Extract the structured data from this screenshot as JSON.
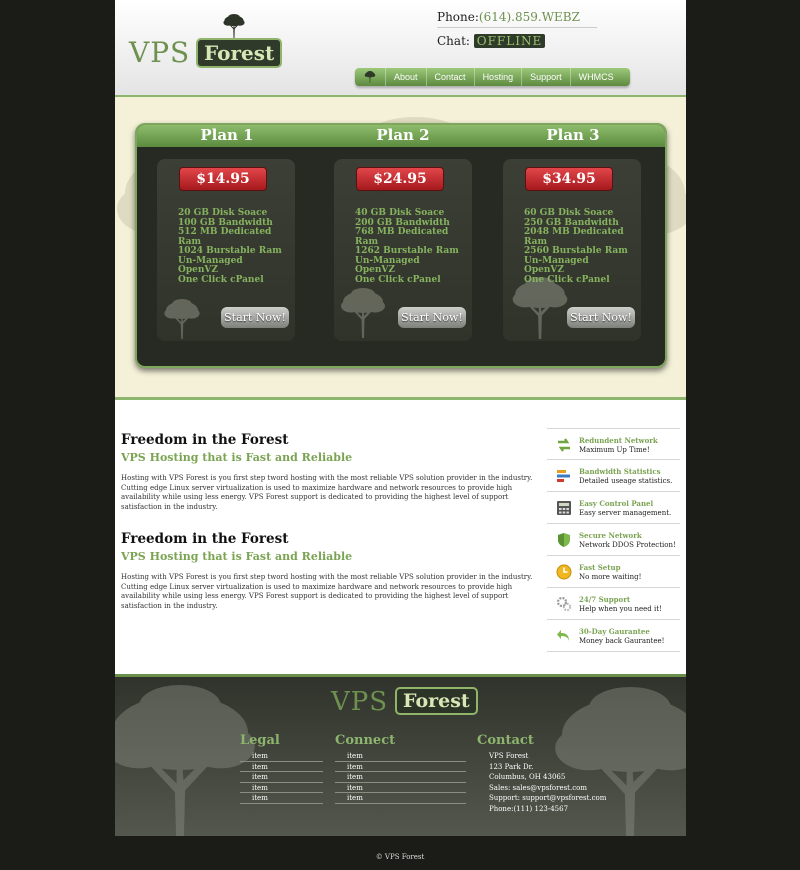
{
  "header": {
    "logo_vps": "VPS",
    "logo_forest": "Forest",
    "phone_label": "Phone:",
    "phone_value": "(614).859.WEBZ",
    "chat_label": "Chat:",
    "chat_status": "OFFLINE",
    "nav": [
      "About",
      "Contact",
      "Hosting",
      "Support",
      "WHMCS"
    ]
  },
  "plans": [
    {
      "title": "Plan 1",
      "price": "$14.95",
      "features": [
        "20 GB Disk Soace",
        "100 GB Bandwidth",
        "512 MB Dedicated Ram",
        "1024 Burstable Ram",
        "Un-Managed",
        "OpenVZ",
        "One Click cPanel"
      ],
      "button": "Start Now!"
    },
    {
      "title": "Plan 2",
      "price": "$24.95",
      "features": [
        "40 GB Disk Soace",
        "200 GB Bandwidth",
        "768 MB Dedicated Ram",
        "1262 Burstable Ram",
        "Un-Managed",
        "OpenVZ",
        "One Click cPanel"
      ],
      "button": "Start Now!"
    },
    {
      "title": "Plan 3",
      "price": "$34.95",
      "features": [
        "60 GB Disk Soace",
        "250 GB Bandwidth",
        "2048 MB Dedicated Ram",
        "2560 Burstable Ram",
        "Un-Managed",
        "OpenVZ",
        "One Click cPanel"
      ],
      "button": "Start Now!"
    }
  ],
  "articles": [
    {
      "title": "Freedom in the Forest",
      "subtitle": "VPS Hosting that is Fast and Reliable",
      "body": "Hosting with VPS Forest is you first step tword hosting with the most reliable VPS solution provider in the industry. Cutting edge Linux server virtualization is used to maximize hardware and network resources to provide high availability while using less energy. VPS Forest support is dedicated to providing the highest level of support satisfaction in the industry."
    },
    {
      "title": "Freedom in the Forest",
      "subtitle": "VPS Hosting that is Fast and Reliable",
      "body": "Hosting with VPS Forest is you first step tword hosting with the most reliable VPS solution provider in the industry. Cutting edge Linux server virtualization is used to maximize hardware and network resources to provide high availability while using less energy. VPS Forest support is dedicated to providing the highest level of support satisfaction in the industry."
    }
  ],
  "sidebar": [
    {
      "title": "Redundent Network",
      "desc": "Maximum Up Time!",
      "icon": "network-arrows-icon"
    },
    {
      "title": "Bandwidth Statistics",
      "desc": "Detailed useage statistics.",
      "icon": "bar-chart-icon"
    },
    {
      "title": "Easy Control Panel",
      "desc": "Easy server management.",
      "icon": "calculator-icon"
    },
    {
      "title": "Secure Network",
      "desc": "Network DDOS Protection!",
      "icon": "shield-icon"
    },
    {
      "title": "Fast Setup",
      "desc": "No more waiting!",
      "icon": "clock-icon"
    },
    {
      "title": "24/7 Support",
      "desc": "Help when you need it!",
      "icon": "gears-icon"
    },
    {
      "title": "30-Day Gaurantee",
      "desc": "Money back Gaurantee!",
      "icon": "return-arrow-icon"
    }
  ],
  "footer": {
    "logo_vps": "VPS",
    "logo_forest": "Forest",
    "legal_title": "Legal",
    "legal_items": [
      "item",
      "item",
      "item",
      "item",
      "item"
    ],
    "connect_title": "Connect",
    "connect_items": [
      "item",
      "item",
      "item",
      "item",
      "item"
    ],
    "contact_title": "Contact",
    "contact_lines": [
      "VPS Forest",
      "123 Park Dr.",
      "Columbus, OH 43065",
      "Sales: sales@vpsforest.com",
      "Support: support@vpsforest.com",
      "Phone:(111) 123-4567"
    ]
  },
  "copyright": "© VPS Forest"
}
